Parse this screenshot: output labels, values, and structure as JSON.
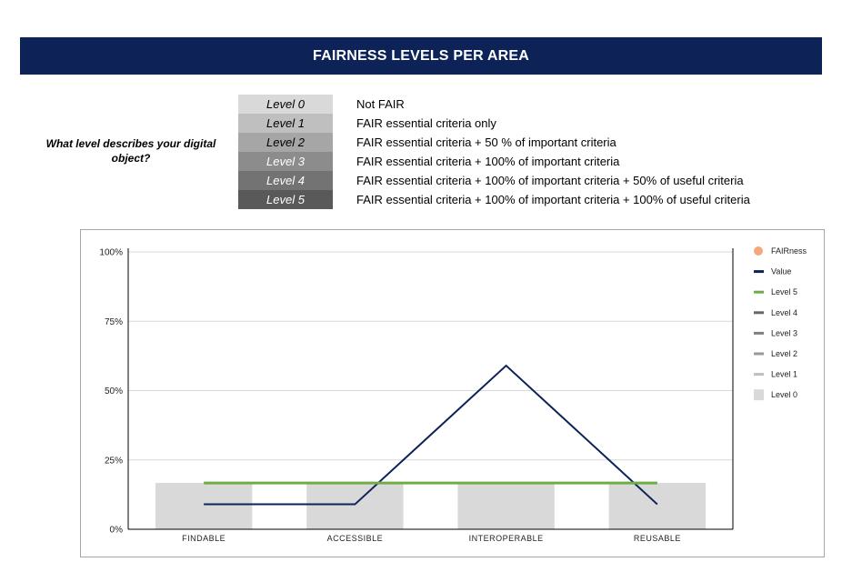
{
  "header": {
    "title": "FAIRNESS LEVELS PER AREA"
  },
  "question": "What level describes your digital object?",
  "levels": [
    {
      "label": "Level 0",
      "description": "Not FAIR",
      "bg": "#d9d9d9",
      "fg": "#000000"
    },
    {
      "label": "Level 1",
      "description": "FAIR essential criteria only",
      "bg": "#bfbfbf",
      "fg": "#000000"
    },
    {
      "label": "Level 2",
      "description": "FAIR essential criteria + 50 % of important criteria",
      "bg": "#a6a6a6",
      "fg": "#000000"
    },
    {
      "label": "Level 3",
      "description": "FAIR essential criteria + 100% of important criteria",
      "bg": "#8c8c8c",
      "fg": "#ffffff"
    },
    {
      "label": "Level 4",
      "description": "FAIR essential criteria + 100% of important criteria + 50% of useful criteria",
      "bg": "#737373",
      "fg": "#ffffff"
    },
    {
      "label": "Level 5",
      "description": "FAIR essential criteria + 100% of important criteria + 100% of useful criteria",
      "bg": "#595959",
      "fg": "#ffffff"
    }
  ],
  "chart_data": {
    "type": "bar",
    "title": "",
    "xlabel": "",
    "ylabel": "",
    "categories": [
      "FINDABLE",
      "ACCESSIBLE",
      "INTEROPERABLE",
      "REUSABLE"
    ],
    "ylim": [
      0,
      1
    ],
    "yticks": [
      "0%",
      "25%",
      "50%",
      "75%",
      "100%"
    ],
    "ytick_values": [
      0,
      0.25,
      0.5,
      0.75,
      1
    ],
    "grid": true,
    "legend_position": "right",
    "series": [
      {
        "name": "FAIRness",
        "kind": "scatter",
        "values": [],
        "color": "#f4a77a"
      },
      {
        "name": "Value",
        "kind": "line",
        "values": [
          0.09,
          0.09,
          0.59,
          0.09
        ],
        "color": "#0d2257"
      },
      {
        "name": "Level 5",
        "kind": "line",
        "values": [
          0.167,
          0.167,
          0.167,
          0.167
        ],
        "color": "#70ad47"
      },
      {
        "name": "Level 4",
        "kind": "line",
        "values": [],
        "color": "#666666"
      },
      {
        "name": "Level 3",
        "kind": "line",
        "values": [],
        "color": "#808080"
      },
      {
        "name": "Level 2",
        "kind": "line",
        "values": [],
        "color": "#999999"
      },
      {
        "name": "Level 1",
        "kind": "line",
        "values": [],
        "color": "#bfbfbf"
      },
      {
        "name": "Level 0",
        "kind": "bar",
        "values": [
          0.167,
          0.167,
          0.167,
          0.167
        ],
        "color": "#d9d9d9"
      }
    ]
  }
}
